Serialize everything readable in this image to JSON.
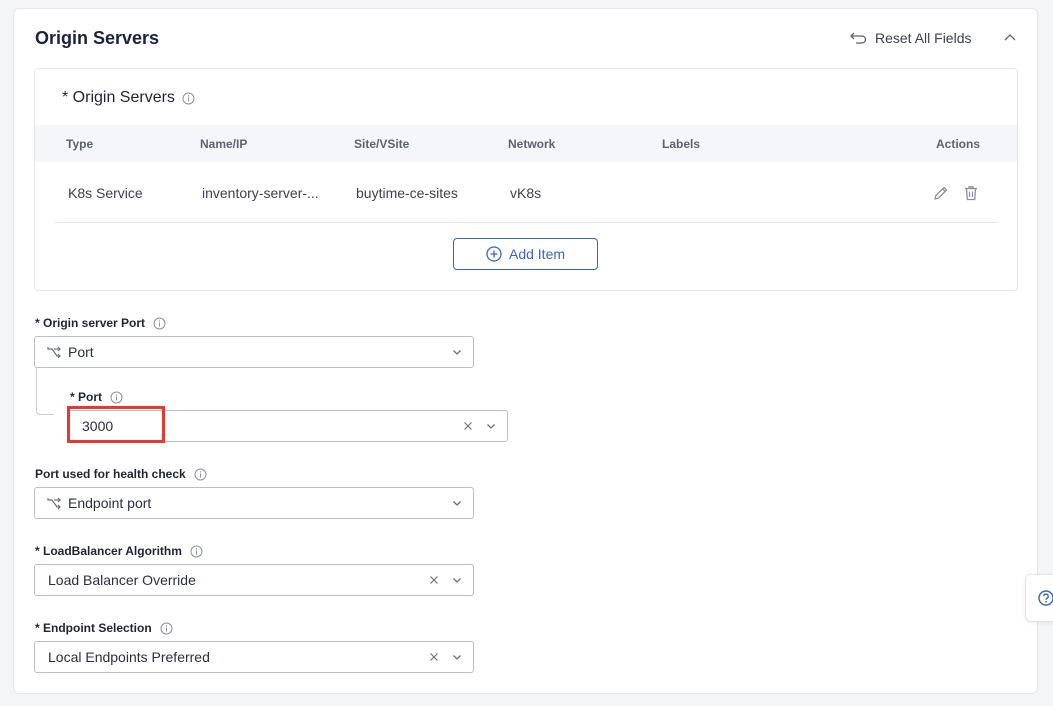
{
  "section": {
    "title": "Origin Servers",
    "reset_label": "Reset All Fields"
  },
  "origin_servers": {
    "label": "* Origin Servers",
    "columns": [
      "Type",
      "Name/IP",
      "Site/VSite",
      "Network",
      "Labels",
      "Actions"
    ],
    "rows": [
      {
        "type": "K8s Service",
        "name": "inventory-server-...",
        "site": "buytime-ce-sites",
        "network": "vK8s",
        "labels": ""
      }
    ],
    "add_item_label": "Add Item"
  },
  "origin_server_port": {
    "label": "* Origin server Port",
    "value": "Port"
  },
  "port": {
    "label": "* Port",
    "value": "3000"
  },
  "health_check_port": {
    "label": "Port used for health check",
    "value": "Endpoint port"
  },
  "lb_algorithm": {
    "label": "* LoadBalancer Algorithm",
    "value": "Load Balancer Override"
  },
  "endpoint_selection": {
    "label": "* Endpoint Selection",
    "value": "Local Endpoints Preferred"
  },
  "colors": {
    "accent": "#3a64c4",
    "highlight": "#e8372f",
    "title": "#19233d"
  }
}
